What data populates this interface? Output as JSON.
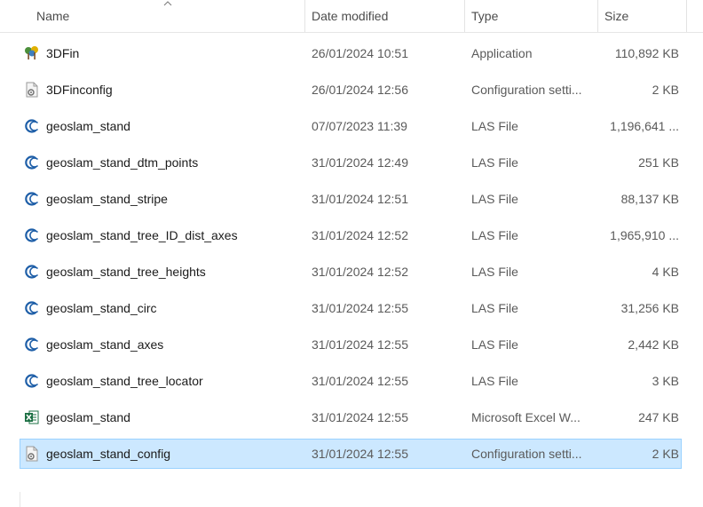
{
  "columns": {
    "name": "Name",
    "date_modified": "Date modified",
    "type": "Type",
    "size": "Size"
  },
  "files": [
    {
      "name": "3DFin",
      "date": "26/01/2024 10:51",
      "type": "Application",
      "size": "110,892 KB",
      "icon": "app-icon"
    },
    {
      "name": "3DFinconfig",
      "date": "26/01/2024 12:56",
      "type": "Configuration setti...",
      "size": "2 KB",
      "icon": "config-file-icon"
    },
    {
      "name": "geoslam_stand",
      "date": "07/07/2023 11:39",
      "type": "LAS File",
      "size": "1,196,641 ...",
      "icon": "las-file-icon"
    },
    {
      "name": "geoslam_stand_dtm_points",
      "date": "31/01/2024 12:49",
      "type": "LAS File",
      "size": "251 KB",
      "icon": "las-file-icon"
    },
    {
      "name": "geoslam_stand_stripe",
      "date": "31/01/2024 12:51",
      "type": "LAS File",
      "size": "88,137 KB",
      "icon": "las-file-icon"
    },
    {
      "name": "geoslam_stand_tree_ID_dist_axes",
      "date": "31/01/2024 12:52",
      "type": "LAS File",
      "size": "1,965,910 ...",
      "icon": "las-file-icon"
    },
    {
      "name": "geoslam_stand_tree_heights",
      "date": "31/01/2024 12:52",
      "type": "LAS File",
      "size": "4 KB",
      "icon": "las-file-icon"
    },
    {
      "name": "geoslam_stand_circ",
      "date": "31/01/2024 12:55",
      "type": "LAS File",
      "size": "31,256 KB",
      "icon": "las-file-icon"
    },
    {
      "name": "geoslam_stand_axes",
      "date": "31/01/2024 12:55",
      "type": "LAS File",
      "size": "2,442 KB",
      "icon": "las-file-icon"
    },
    {
      "name": "geoslam_stand_tree_locator",
      "date": "31/01/2024 12:55",
      "type": "LAS File",
      "size": "3 KB",
      "icon": "las-file-icon"
    },
    {
      "name": "geoslam_stand",
      "date": "31/01/2024 12:55",
      "type": "Microsoft Excel W...",
      "size": "247 KB",
      "icon": "excel-file-icon"
    },
    {
      "name": "geoslam_stand_config",
      "date": "31/01/2024 12:55",
      "type": "Configuration setti...",
      "size": "2 KB",
      "icon": "config-file-icon",
      "selected": true
    }
  ],
  "colors": {
    "selection_bg": "#cce8ff",
    "selection_border": "#99d1ff",
    "las_icon_blue": "#1f5fa8",
    "excel_green": "#1d7044"
  }
}
